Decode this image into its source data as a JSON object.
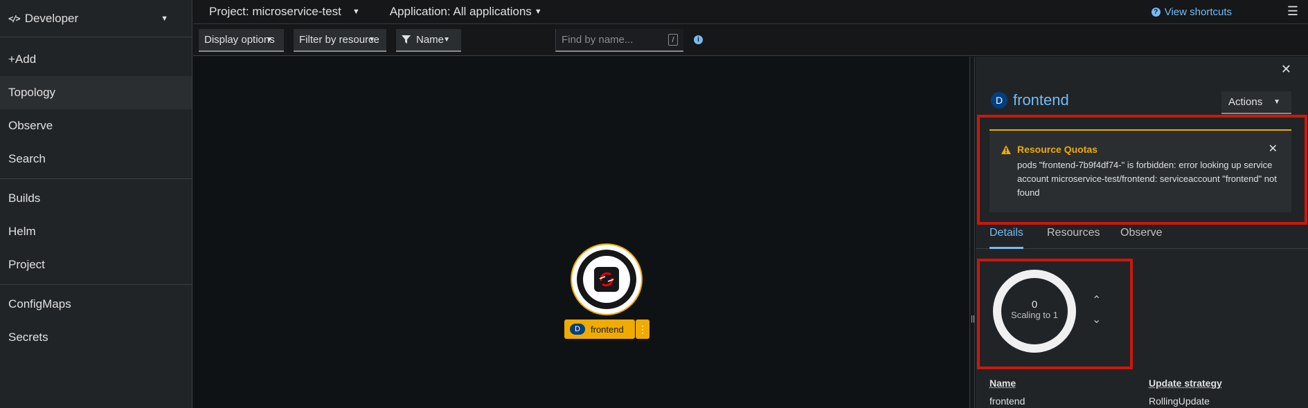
{
  "sidebar": {
    "perspective": "Developer",
    "items": [
      {
        "label": "+Add"
      },
      {
        "label": "Topology"
      },
      {
        "label": "Observe"
      },
      {
        "label": "Search"
      },
      {
        "label": "Builds"
      },
      {
        "label": "Helm"
      },
      {
        "label": "Project"
      },
      {
        "label": "ConfigMaps"
      },
      {
        "label": "Secrets"
      }
    ],
    "active": "Topology"
  },
  "topbar": {
    "project": "Project: microservice-test",
    "application": "Application: All applications",
    "shortcuts": "View shortcuts"
  },
  "toolbar": {
    "display_options": "Display options",
    "filter_by_resource": "Filter by resource",
    "filter_type": "Name",
    "search_placeholder": "Find by name...",
    "search_shortcut": "/"
  },
  "topology": {
    "node": {
      "kind_badge": "D",
      "name": "frontend"
    }
  },
  "panel": {
    "kind_badge": "D",
    "title": "frontend",
    "actions_label": "Actions",
    "alert": {
      "title": "Resource Quotas",
      "body": "pods \"frontend-7b9f4df74-\" is forbidden: error looking up service account microservice-test/frontend: serviceaccount \"frontend\" not found"
    },
    "tabs": [
      {
        "label": "Details"
      },
      {
        "label": "Resources"
      },
      {
        "label": "Observe"
      }
    ],
    "active_tab": "Details",
    "pods": {
      "count": "0",
      "status": "Scaling to 1"
    },
    "details": {
      "name_label": "Name",
      "name_value": "frontend",
      "strategy_label": "Update strategy",
      "strategy_value": "RollingUpdate"
    }
  },
  "colors": {
    "accent": "#73bcf7",
    "warning": "#f0ab00",
    "highlight": "#c9190b"
  }
}
